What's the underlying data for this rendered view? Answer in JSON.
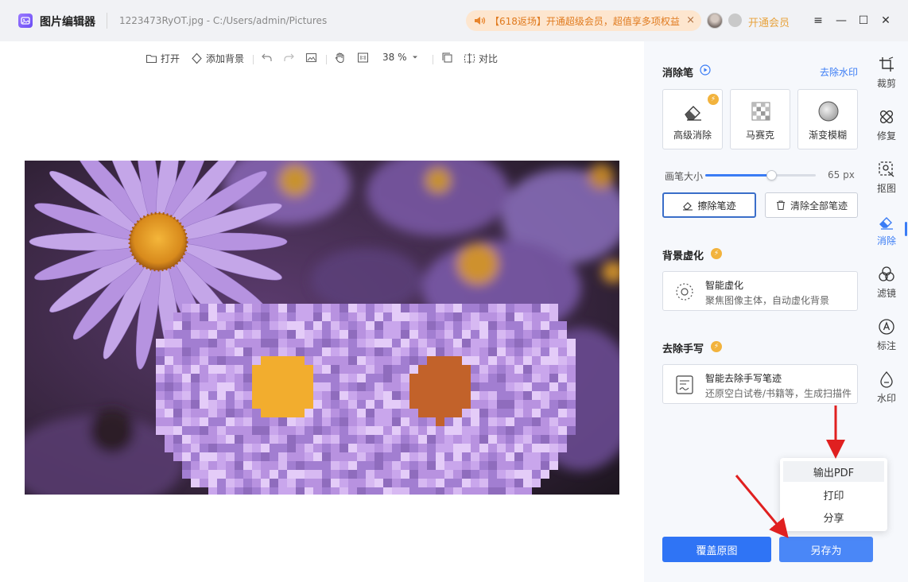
{
  "titlebar": {
    "app_name": "图片编辑器",
    "file_title": "1223473RyOT.jpg - C:/Users/admin/Pictures",
    "promo_text": "【618返场】开通超级会员，超值享多项权益",
    "promo_close": "×",
    "vip_link": "开通会员",
    "menu_icon": "≡",
    "minimize_icon": "—",
    "maximize_icon": "☐",
    "close_icon": "✕"
  },
  "toolbar": {
    "open_label": "打开",
    "add_bg_label": "添加背景",
    "zoom_value": "38 %",
    "compare_label": "对比"
  },
  "panel": {
    "eraser_title": "消除笔",
    "remove_watermark_link": "去除水印",
    "tools": [
      {
        "label": "高级消除",
        "icon": "eraser-icon",
        "premium": true
      },
      {
        "label": "马赛克",
        "icon": "mosaic-icon",
        "premium": false
      },
      {
        "label": "渐变模糊",
        "icon": "blur-circle-icon",
        "premium": false
      }
    ],
    "brush_size_label": "画笔大小",
    "brush_size_value": "65 px",
    "brush_size_fraction": 0.6,
    "erase_strokes_label": "擦除笔迹",
    "clear_all_strokes_label": "清除全部笔迹",
    "bg_blur_title": "背景虚化",
    "smart_blur_title": "智能虚化",
    "smart_blur_desc": "聚焦图像主体，自动虚化背景",
    "remove_handwriting_title": "去除手写",
    "smart_handwriting_title": "智能去除手写笔迹",
    "smart_handwriting_desc": "还原空白试卷/书籍等，生成扫描件",
    "overwrite_button": "覆盖原图",
    "save_as_button": "另存为"
  },
  "dropdown": {
    "items": [
      "输出PDF",
      "打印",
      "分享"
    ]
  },
  "sidebar": {
    "items": [
      {
        "label": "裁剪",
        "icon": "crop-icon"
      },
      {
        "label": "修复",
        "icon": "bandage-icon"
      },
      {
        "label": "抠图",
        "icon": "cutout-icon"
      },
      {
        "label": "消除",
        "icon": "eraser-icon",
        "active": true
      },
      {
        "label": "滤镜",
        "icon": "filter-icon"
      },
      {
        "label": "标注",
        "icon": "annotate-icon"
      },
      {
        "label": "水印",
        "icon": "watermark-icon"
      }
    ]
  },
  "colors": {
    "accent": "#2f74f5",
    "promo_bg": "#fde6cf",
    "promo_text": "#e07a1e",
    "vip": "#e8a33d",
    "arrow": "#e02020"
  }
}
